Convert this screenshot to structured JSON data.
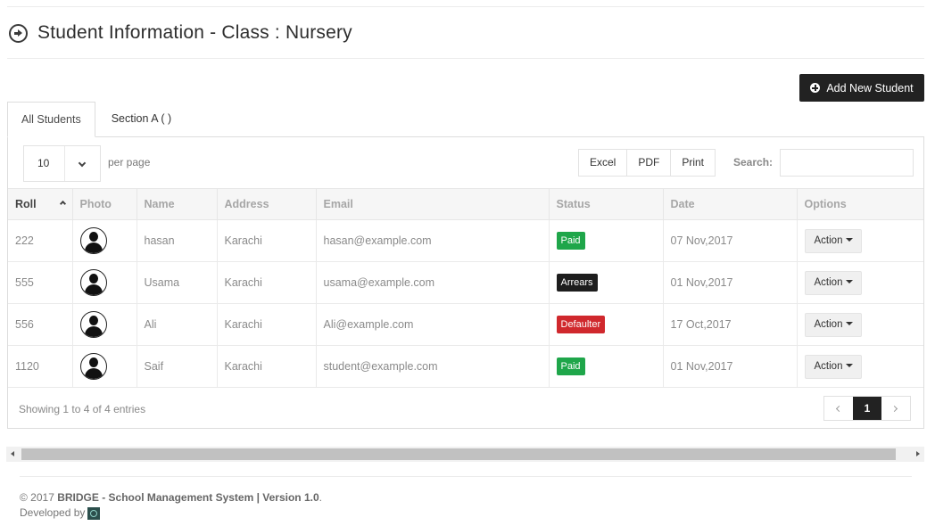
{
  "header": {
    "title": "Student Information - Class : Nursery"
  },
  "actions": {
    "add_student_label": "Add New Student"
  },
  "tabs": [
    {
      "label": "All Students",
      "active": true
    },
    {
      "label": "Section A ( )",
      "active": false
    }
  ],
  "table_controls": {
    "page_length": "10",
    "per_page_label": "per page",
    "export_buttons": [
      "Excel",
      "PDF",
      "Print"
    ],
    "search_label": "Search:",
    "search_value": ""
  },
  "table": {
    "columns": [
      "Roll",
      "Photo",
      "Name",
      "Address",
      "Email",
      "Status",
      "Date",
      "Options"
    ],
    "sorted_column": "Roll",
    "sort_direction": "asc",
    "rows": [
      {
        "roll": "222",
        "name": "hasan",
        "address": "Karachi",
        "email": "hasan@example.com",
        "status": "Paid",
        "status_color": "#1fa64a",
        "date": "07 Nov,2017",
        "action": "Action"
      },
      {
        "roll": "555",
        "name": "Usama",
        "address": "Karachi",
        "email": "usama@example.com",
        "status": "Arrears",
        "status_color": "#1d1d1d",
        "date": "01 Nov,2017",
        "action": "Action"
      },
      {
        "roll": "556",
        "name": "Ali",
        "address": "Karachi",
        "email": "Ali@example.com",
        "status": "Defaulter",
        "status_color": "#d0282d",
        "date": "17 Oct,2017",
        "action": "Action"
      },
      {
        "roll": "1120",
        "name": "Saif",
        "address": "Karachi",
        "email": "student@example.com",
        "status": "Paid",
        "status_color": "#1fa64a",
        "date": "01 Nov,2017",
        "action": "Action"
      }
    ]
  },
  "pagination": {
    "summary": "Showing 1 to 4 of 4 entries",
    "current_page": "1"
  },
  "footer": {
    "copyright": "© 2017",
    "product_name": "BRIDGE - School Management System | Version 1.0",
    "developed_by": "Developed by"
  },
  "icons": {
    "header": "circle-arrow-right-icon",
    "add": "plus-circle-icon",
    "avatar": "user-silhouette-icon",
    "dropdown": "chevron-down-icon"
  }
}
